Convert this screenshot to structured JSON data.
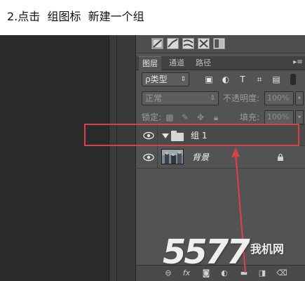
{
  "caption": "2.点击  组图标  新建一个组",
  "panel": {
    "tabs": [
      {
        "label": "图层",
        "active": true
      },
      {
        "label": "通道",
        "active": false
      },
      {
        "label": "路径",
        "active": false
      }
    ],
    "menu_icon": "panel-menu-icon",
    "filter": {
      "kind_label": "ρ类型",
      "icons": [
        "image-filter-icon",
        "adjustment-filter-icon",
        "type-filter-icon",
        "shape-filter-icon",
        "smart-object-filter-icon"
      ]
    },
    "blend": {
      "mode": "正常",
      "opacity_label": "不透明度:",
      "opacity_value": "100%"
    },
    "lock": {
      "label": "锁定:",
      "icons": [
        "lock-transparent-icon",
        "lock-paint-icon",
        "lock-move-icon",
        "lock-all-icon"
      ],
      "fill_label": "填充:",
      "fill_value": "100%"
    },
    "layers": [
      {
        "name": "组 1",
        "type": "group",
        "visible": true
      },
      {
        "name": "背景",
        "type": "background",
        "visible": true,
        "locked": true
      }
    ],
    "bottom_icons": [
      "link-icon",
      "fx-icon",
      "mask-icon",
      "adjustment-icon",
      "new-group-icon",
      "new-layer-icon",
      "delete-icon"
    ]
  },
  "watermark": {
    "number": "5577",
    "text": "我机网"
  },
  "colors": {
    "highlight": "#d9404a",
    "panel_bg": "#535353",
    "canvas_bg": "#2b2b2b"
  }
}
